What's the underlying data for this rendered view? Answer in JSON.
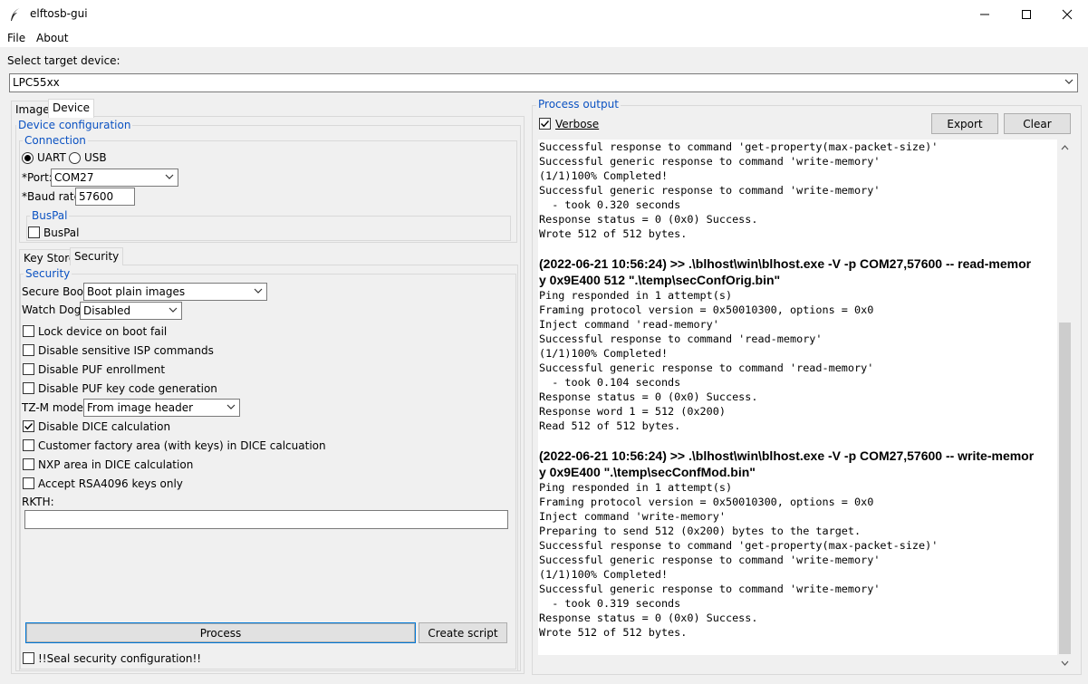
{
  "window": {
    "title": "elftosb-gui",
    "minimize": "—",
    "maximize": "☐",
    "close": "✕"
  },
  "menu": {
    "file": "File",
    "about": "About"
  },
  "target": {
    "label": "Select target device:",
    "value": "LPC55xx"
  },
  "tabs": {
    "image": "Image",
    "device": "Device"
  },
  "device_config": {
    "title": "Device configuration",
    "connection": {
      "title": "Connection",
      "uart": "UART",
      "usb": "USB",
      "selected": "UART",
      "port_label": "*Port:",
      "port_value": "COM27",
      "baud_label": "*Baud rate:",
      "baud_value": "57600"
    },
    "buspal": {
      "title": "BusPal",
      "checkbox_label": "BusPal",
      "checked": false
    }
  },
  "subtabs": {
    "keystore": "Key Store",
    "security": "Security"
  },
  "security": {
    "title": "Security",
    "secure_boot_label": "Secure Boot:",
    "secure_boot_value": "Boot plain images",
    "watchdog_label": "Watch Dog:",
    "watchdog_value": "Disabled",
    "options": [
      {
        "label": "Lock device on boot fail",
        "checked": false
      },
      {
        "label": "Disable sensitive ISP commands",
        "checked": false
      },
      {
        "label": "Disable PUF enrollment",
        "checked": false
      },
      {
        "label": "Disable PUF key code generation",
        "checked": false
      }
    ],
    "tzm_label": "TZ-M mode:",
    "tzm_value": "From image header",
    "options2": [
      {
        "label": "Disable DICE calculation",
        "checked": true
      },
      {
        "label": "Customer factory area (with keys) in DICE calcuation",
        "checked": false
      },
      {
        "label": "NXP area in DICE calculation",
        "checked": false
      },
      {
        "label": "Accept RSA4096 keys only",
        "checked": false
      }
    ],
    "rkth_label": "RKTH:",
    "rkth_value": ""
  },
  "buttons": {
    "process": "Process",
    "create_script": "Create script"
  },
  "seal": {
    "label": "!!Seal security configuration!!",
    "checked": false
  },
  "process_output": {
    "title": "Process output",
    "verbose_label": "Verbose",
    "verbose_checked": true,
    "export": "Export",
    "clear": "Clear",
    "lines": [
      {
        "t": "line",
        "text": "Successful response to command 'get-property(max-packet-size)'"
      },
      {
        "t": "line",
        "text": "Successful generic response to command 'write-memory'"
      },
      {
        "t": "line",
        "text": "(1/1)100% Completed!"
      },
      {
        "t": "line",
        "text": "Successful generic response to command 'write-memory'"
      },
      {
        "t": "line",
        "text": "  - took 0.320 seconds"
      },
      {
        "t": "line",
        "text": "Response status = 0 (0x0) Success."
      },
      {
        "t": "line",
        "text": "Wrote 512 of 512 bytes."
      },
      {
        "t": "gap",
        "text": ""
      },
      {
        "t": "cmd",
        "text": "(2022-06-21 10:56:24) >> .\\blhost\\win\\blhost.exe -V -p COM27,57600 -- read-memor"
      },
      {
        "t": "cmd",
        "text": "y 0x9E400 512 \".\\temp\\secConfOrig.bin\""
      },
      {
        "t": "line",
        "text": "Ping responded in 1 attempt(s)"
      },
      {
        "t": "line",
        "text": "Framing protocol version = 0x50010300, options = 0x0"
      },
      {
        "t": "line",
        "text": "Inject command 'read-memory'"
      },
      {
        "t": "line",
        "text": "Successful response to command 'read-memory'"
      },
      {
        "t": "line",
        "text": "(1/1)100% Completed!"
      },
      {
        "t": "line",
        "text": "Successful generic response to command 'read-memory'"
      },
      {
        "t": "line",
        "text": "  - took 0.104 seconds"
      },
      {
        "t": "line",
        "text": "Response status = 0 (0x0) Success."
      },
      {
        "t": "line",
        "text": "Response word 1 = 512 (0x200)"
      },
      {
        "t": "line",
        "text": "Read 512 of 512 bytes."
      },
      {
        "t": "gap",
        "text": ""
      },
      {
        "t": "cmd",
        "text": "(2022-06-21 10:56:24) >> .\\blhost\\win\\blhost.exe -V -p COM27,57600 -- write-memor"
      },
      {
        "t": "cmd",
        "text": "y 0x9E400 \".\\temp\\secConfMod.bin\""
      },
      {
        "t": "line",
        "text": "Ping responded in 1 attempt(s)"
      },
      {
        "t": "line",
        "text": "Framing protocol version = 0x50010300, options = 0x0"
      },
      {
        "t": "line",
        "text": "Inject command 'write-memory'"
      },
      {
        "t": "line",
        "text": "Preparing to send 512 (0x200) bytes to the target."
      },
      {
        "t": "line",
        "text": "Successful response to command 'get-property(max-packet-size)'"
      },
      {
        "t": "line",
        "text": "Successful generic response to command 'write-memory'"
      },
      {
        "t": "line",
        "text": "(1/1)100% Completed!"
      },
      {
        "t": "line",
        "text": "Successful generic response to command 'write-memory'"
      },
      {
        "t": "line",
        "text": "  - took 0.319 seconds"
      },
      {
        "t": "line",
        "text": "Response status = 0 (0x0) Success."
      },
      {
        "t": "line",
        "text": "Wrote 512 of 512 bytes."
      }
    ]
  }
}
